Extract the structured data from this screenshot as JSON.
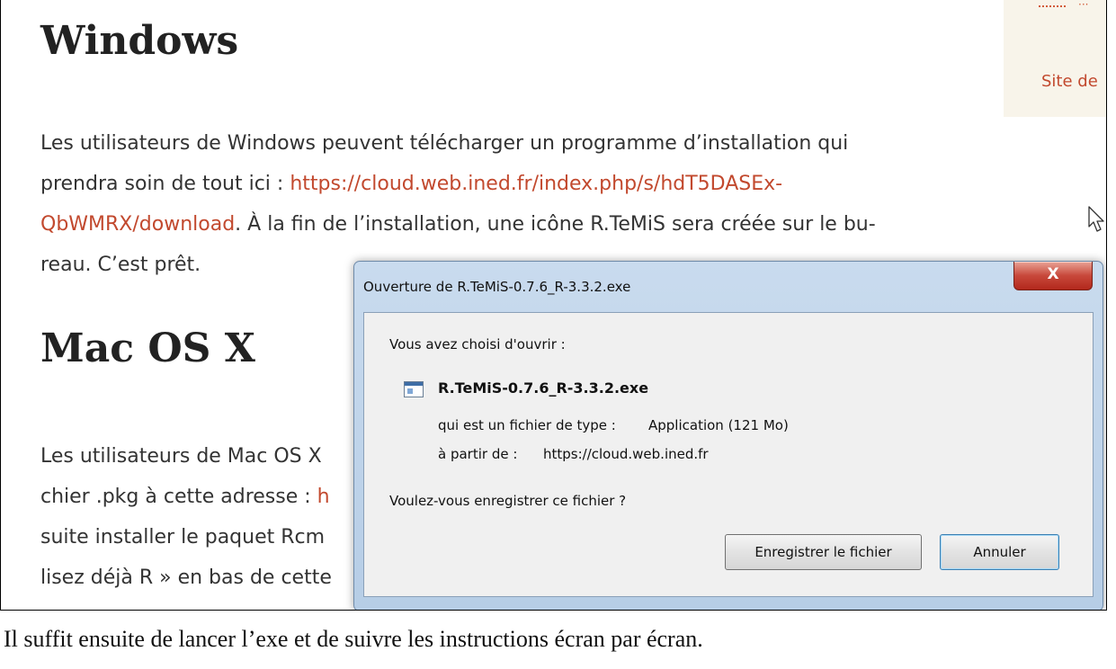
{
  "page": {
    "heading_windows": "Windows",
    "windows_para": [
      {
        "text": "Les utilisateurs de Windows peuvent télécharger un programme d’installation qui",
        "link": ""
      },
      {
        "text": "prendra soin de tout ici : ",
        "link": "https://cloud.web.ined.fr/index.php/s/hdT5DASEx-"
      },
      {
        "text": ". À la fin de l’installation, une icône R.TeMiS sera créée sur le bu-",
        "link": "QbWMRX/download"
      },
      {
        "text": "reau. C’est prêt.",
        "link": ""
      }
    ],
    "heading_mac": "Mac OS X",
    "mac_para": [
      {
        "text": "Les utilisateurs de Mac OS X",
        "link": ""
      },
      {
        "text": "chier .pkg à cette adresse : ",
        "link": "h"
      },
      {
        "text": "suite installer le paquet Rcm",
        "link": ""
      },
      {
        "text": "lisez déjà R » en bas de cette",
        "link": ""
      }
    ],
    "sidebar_link": "Site de",
    "sidebar_mark": "···"
  },
  "dialog": {
    "title": "Ouverture de R.TeMiS-0.7.6_R-3.3.2.exe",
    "close_label": "X",
    "intro": "Vous avez choisi d'ouvrir :",
    "filename": "R.TeMiS-0.7.6_R-3.3.2.exe",
    "type_label": "qui est un fichier de type :",
    "type_value": "Application (121 Mo)",
    "from_label": "à partir de :",
    "from_value": "https://cloud.web.ined.fr",
    "question": "Voulez-vous enregistrer ce fichier ?",
    "save_button": "Enregistrer le fichier",
    "cancel_button": "Annuler"
  },
  "caption": "Il suffit ensuite de lancer l’exe et de suivre les instructions écran par écran."
}
